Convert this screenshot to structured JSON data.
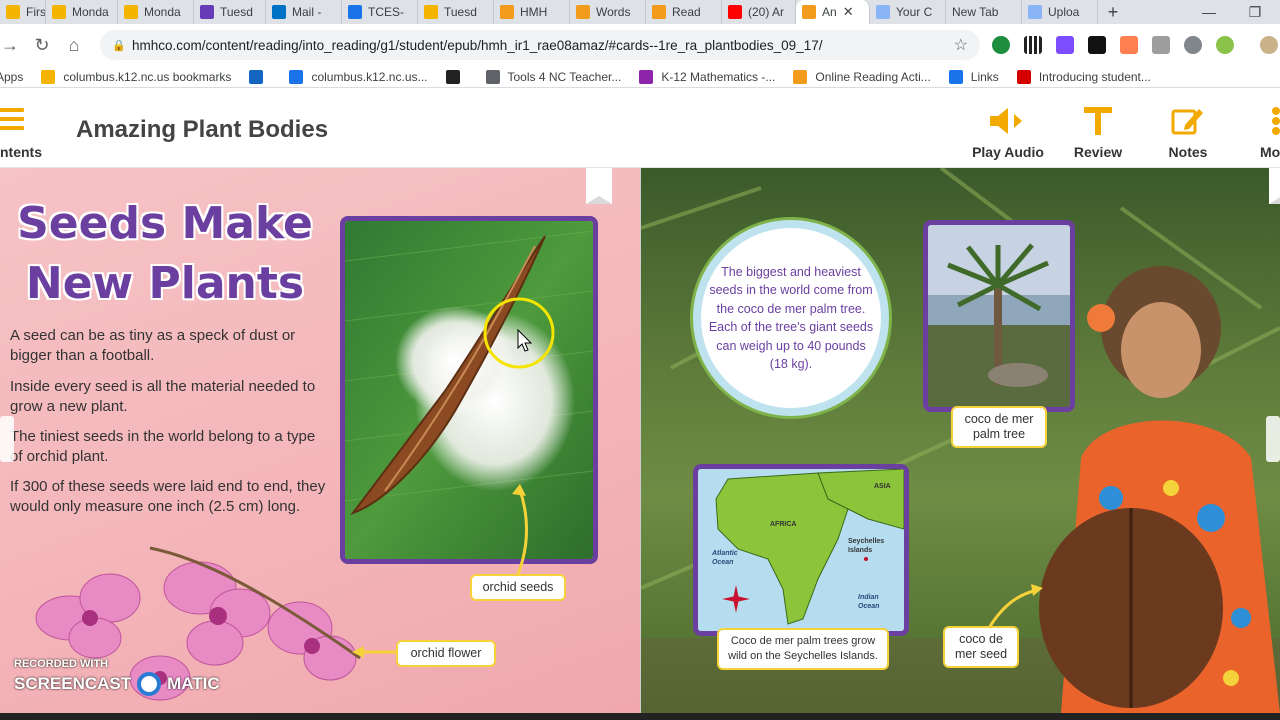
{
  "tabs": [
    {
      "label": "First G",
      "color": "#f4b400"
    },
    {
      "label": "Monda",
      "color": "#f4b400"
    },
    {
      "label": "Monda",
      "color": "#f4b400"
    },
    {
      "label": "Tuesd",
      "color": "#673ab7"
    },
    {
      "label": "Mail -",
      "color": "#0072c6"
    },
    {
      "label": "TCES-",
      "color": "#1a73e8"
    },
    {
      "label": "Tuesd",
      "color": "#f4b400"
    },
    {
      "label": "HMH",
      "color": "#f29b1d"
    },
    {
      "label": "Words",
      "color": "#f29b1d"
    },
    {
      "label": "Read",
      "color": "#f29b1d"
    },
    {
      "label": "(20) Ar",
      "color": "#ff0000"
    },
    {
      "label": "An",
      "color": "#f29b1d",
      "active": true
    },
    {
      "label": "Your C",
      "color": "#8ab4f8"
    },
    {
      "label": "New Tab",
      "color": ""
    },
    {
      "label": "Uploa",
      "color": "#8ab4f8"
    }
  ],
  "browser": {
    "url": "hmhco.com/content/reading/into_reading/g1/student/epub/hmh_ir1_rae08amaz/#cards--1re_ra_plantbodies_09_17/"
  },
  "bookmarks": [
    {
      "label": "Apps",
      "icon": "apps-icon"
    },
    {
      "label": "columbus.k12.nc.us bookmarks",
      "icon": "folder-icon"
    },
    {
      "label": "",
      "icon": "s-icon"
    },
    {
      "label": "columbus.k12.nc.us...",
      "icon": "page-icon"
    },
    {
      "label": "",
      "icon": "qr-icon"
    },
    {
      "label": "Tools 4 NC Teacher...",
      "icon": "globe-icon"
    },
    {
      "label": "K-12 Mathematics -...",
      "icon": "math-icon"
    },
    {
      "label": "Online Reading Acti...",
      "icon": "chart-icon"
    },
    {
      "label": "Links",
      "icon": "dots-icon"
    },
    {
      "label": "Introducing student...",
      "icon": "k-icon"
    }
  ],
  "app": {
    "contents_label": "ntents",
    "title": "Amazing Plant Bodies",
    "buttons": {
      "play_audio": "Play Audio",
      "review": "Review",
      "notes": "Notes",
      "more": "Mo"
    }
  },
  "left_page": {
    "heading_line1": "Seeds Make",
    "heading_line2": "New Plants",
    "paragraphs": [
      "A seed can be as tiny as a speck of dust or bigger than a football.",
      "Inside every seed is all the material needed to grow a new plant.",
      "The tiniest seeds in the world belong to a type of orchid plant.",
      "If 300 of these seeds were laid end to end, they would only measure one inch (2.5 cm) long."
    ],
    "captions": {
      "orchid_seeds": "orchid seeds",
      "orchid_flower": "orchid flower"
    }
  },
  "right_page": {
    "fact": "The biggest and heaviest seeds in the world come from the coco de mer palm tree. Each of the tree's giant seeds can weigh up to 40 pounds (18 kg).",
    "captions": {
      "palm_tree": "coco de mer palm tree",
      "map": "Coco de mer palm trees grow wild on the Seychelles Islands.",
      "seed": "coco de mer seed"
    },
    "map_labels": {
      "asia": "ASIA",
      "africa": "AFRICA",
      "seychelles": "Seychelles Islands",
      "atlantic": "Atlantic Ocean",
      "indian": "Indian Ocean",
      "n": "N",
      "s": "S",
      "e": "E",
      "w": "W"
    }
  },
  "watermark": {
    "line1": "RECORDED WITH",
    "line2a": "SCREENCAST",
    "line2b": "MATIC"
  }
}
